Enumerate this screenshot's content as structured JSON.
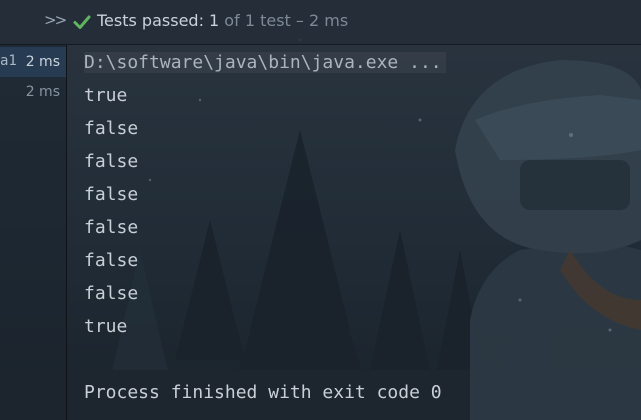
{
  "toolbar": {
    "expand_icon": ">>",
    "status_icon": "check-icon",
    "status_passed": "Tests passed: 1",
    "status_detail": " of 1 test – 2 ms"
  },
  "tree": {
    "rows": [
      {
        "name": "a1",
        "time": "2 ms",
        "selected": true
      },
      {
        "name": "",
        "time": "2 ms",
        "selected": false
      }
    ]
  },
  "console": {
    "command": "D:\\software\\java\\bin\\java.exe ...",
    "lines": [
      "true",
      "false",
      "false",
      "false",
      "false",
      "false",
      "false",
      "true"
    ],
    "exit_message": "Process finished with exit code 0"
  },
  "colors": {
    "pass_green": "#5fb55f",
    "text": "#c8cfd6",
    "muted": "#7d8a96"
  }
}
